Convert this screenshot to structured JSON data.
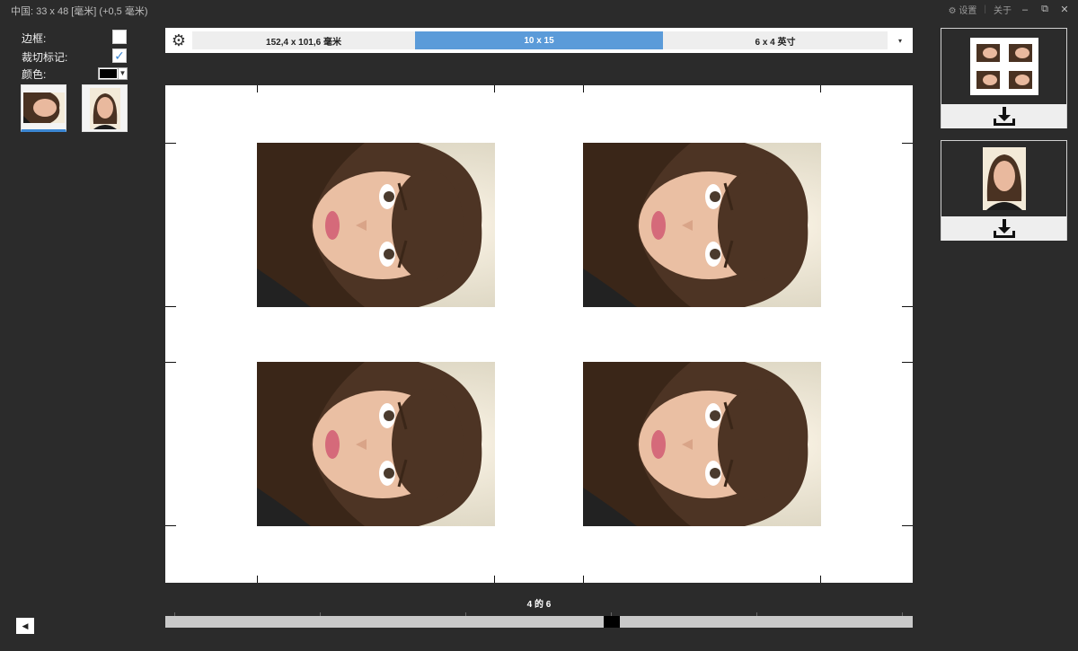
{
  "window": {
    "title": "中国: 33 x 48 [毫米] (+0,5 毫米)",
    "settings": "设置",
    "about": "关于",
    "minimize": "–",
    "restore": "⧉",
    "close": "✕"
  },
  "options": {
    "border_label": "边框:",
    "crop_marks_label": "裁切标记:",
    "crop_marks_checked": true,
    "color_label": "颜色:",
    "color_value": "#000000"
  },
  "formats": [
    {
      "label": "152,4 x 101,6 毫米",
      "selected": false
    },
    {
      "label": "10 x 15",
      "selected": true
    },
    {
      "label": "6 x 4 英寸",
      "selected": false
    }
  ],
  "pager": {
    "text": "4 的 6",
    "current": 4,
    "total": 6
  },
  "back_icon": "◀",
  "icons": {
    "gear": "gear-icon",
    "download": "download-icon"
  }
}
